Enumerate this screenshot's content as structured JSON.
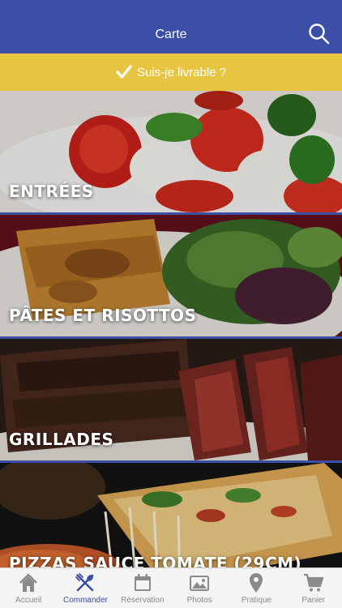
{
  "header": {
    "title": "Carte"
  },
  "delivery": {
    "label": "Suis-je livrable ?"
  },
  "categories": [
    {
      "label": "ENTRÉES"
    },
    {
      "label": "PÂTES ET RISOTTOS"
    },
    {
      "label": "GRILLADES"
    },
    {
      "label": "PIZZAS SAUCE TOMATE (29CM)"
    }
  ],
  "tabbar": {
    "tabs": [
      {
        "label": "Accueil",
        "icon": "home-icon"
      },
      {
        "label": "Commander",
        "icon": "cutlery-icon"
      },
      {
        "label": "Réservation",
        "icon": "calendar-icon"
      },
      {
        "label": "Photos",
        "icon": "photos-icon"
      },
      {
        "label": "Pratique",
        "icon": "map-pin-icon"
      },
      {
        "label": "Panier",
        "icon": "cart-icon"
      }
    ],
    "active_index": 1
  },
  "colors": {
    "primary": "#3a4fa5",
    "accent": "#e8c540",
    "inactive": "#8a8a8a"
  }
}
